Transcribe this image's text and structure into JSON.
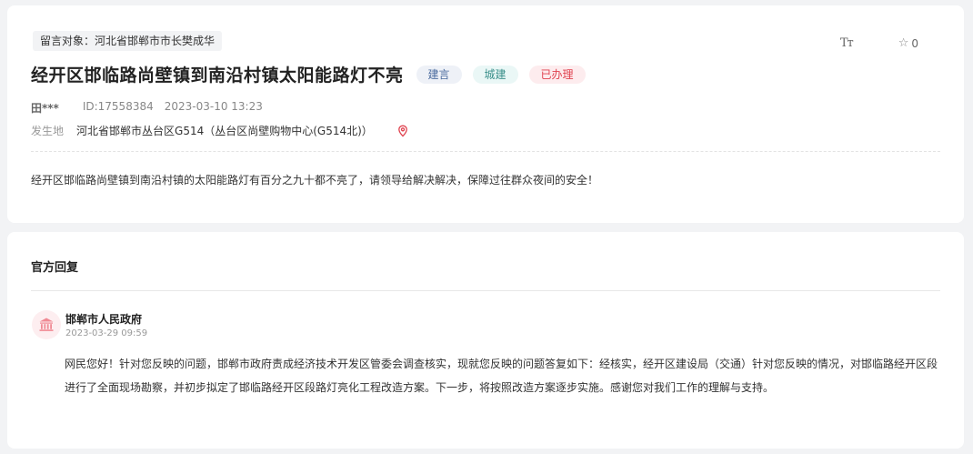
{
  "message": {
    "target_label": "留言对象：河北省邯郸市市长樊成华",
    "font_tool": "Tт",
    "favorite_count": "0",
    "title": "经开区邯临路尚壁镇到南沿村镇太阳能路灯不亮",
    "tags": {
      "type": "建言",
      "domain": "城建",
      "status": "已办理"
    },
    "author": "田***",
    "id": "ID:17558384",
    "time": "2023-03-10 13:23",
    "location_label": "发生地",
    "location": "河北省邯郸市丛台区G514（丛台区尚壁购物中心(G514北)）",
    "content": "经开区邯临路尚壁镇到南沿村镇的太阳能路灯有百分之九十都不亮了，请领导给解决解决，保障过往群众夜间的安全！"
  },
  "reply": {
    "section_title": "官方回复",
    "org": "邯郸市人民政府",
    "time": "2023-03-29 09:59",
    "text": "网民您好！针对您反映的问题，邯郸市政府责成经济技术开发区管委会调查核实，现就您反映的问题答复如下：经核实，经开区建设局（交通）针对您反映的情况，对邯临路经开区段进行了全面现场勘察，并初步拟定了邯临路经开区段路灯亮化工程改造方案。下一步，将按照改造方案逐步实施。感谢您对我们工作的理解与支持。"
  },
  "colors": {
    "status_red": "#e0424f",
    "domain_teal": "#3a8f8a",
    "type_blue": "#4a6b9e",
    "page_bg": "#f2f3f5"
  },
  "icons": {
    "font_size": "font-size-icon",
    "favorite": "star-icon",
    "location": "location-pin-icon",
    "org_avatar": "government-building-icon"
  }
}
